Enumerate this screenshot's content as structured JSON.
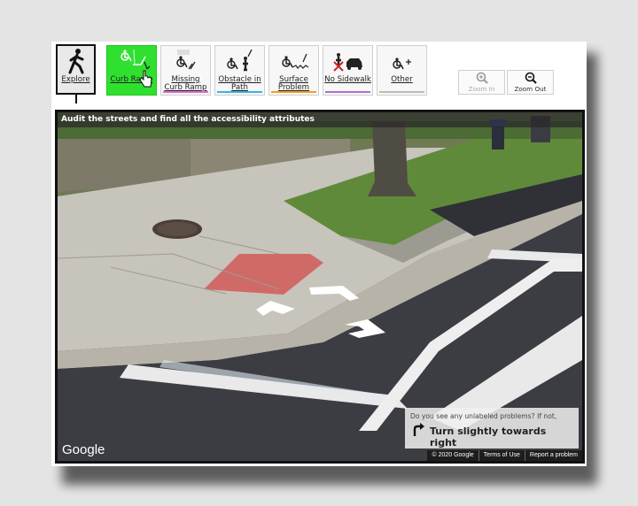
{
  "toolbar": {
    "tools": [
      {
        "id": "explore",
        "label": "Explore",
        "icon": "walking-person-icon",
        "active": false
      },
      {
        "id": "curb-ramp",
        "label": "Curb Ramp",
        "icon": "curb-ramp-icon",
        "active": true,
        "color": "#2fe02f"
      },
      {
        "id": "missing-curb-ramp",
        "label": "Missing Curb Ramp",
        "icon": "missing-curb-ramp-icon",
        "color": "#e06bd2"
      },
      {
        "id": "obstacle",
        "label": "Obstacle in Path",
        "icon": "obstacle-icon",
        "color": "#3cb0e8"
      },
      {
        "id": "surface-problem",
        "label": "Surface Problem",
        "icon": "surface-problem-icon",
        "color": "#f0a020"
      },
      {
        "id": "no-sidewalk",
        "label": "No Sidewalk",
        "icon": "no-sidewalk-icon",
        "color": "#b06bd2"
      },
      {
        "id": "other",
        "label": "Other",
        "icon": "other-icon",
        "color": "#bbbbbb"
      }
    ],
    "zoom_in_label": "Zoom In",
    "zoom_out_label": "Zoom Out"
  },
  "viewer": {
    "banner": "Audit the streets and find all the accessibility attributes",
    "logo_text": "Google",
    "prompt_question": "Do you see any unlabeled problems? If not,",
    "prompt_action": "Turn slightly towards right",
    "footer": {
      "copyright": "© 2020 Google",
      "terms": "Terms of Use",
      "report": "Report a problem"
    }
  }
}
